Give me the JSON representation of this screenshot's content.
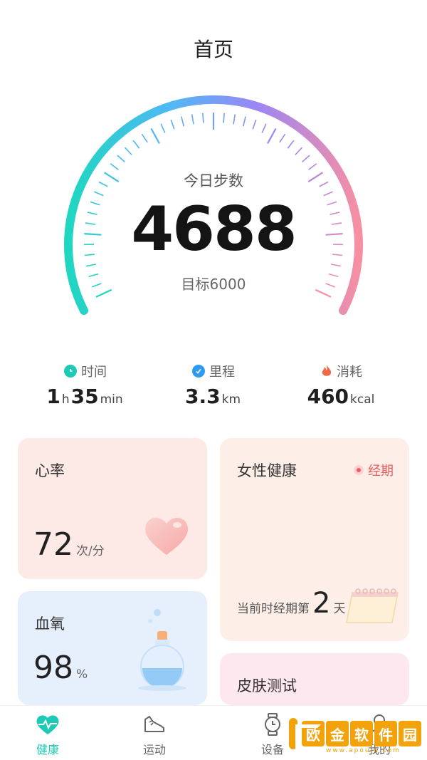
{
  "header": {
    "title": "首页"
  },
  "steps": {
    "label": "今日步数",
    "value": "4688",
    "target_label": "目标6000",
    "progress": 0.78
  },
  "stats": [
    {
      "name": "时间",
      "icon": "clock-icon",
      "color": "#1ec9b5",
      "parts": [
        "1",
        "h",
        "35",
        "min"
      ]
    },
    {
      "name": "里程",
      "icon": "check-icon",
      "color": "#2f9bf0",
      "parts": [
        "3.3",
        "km"
      ]
    },
    {
      "name": "消耗",
      "icon": "flame-icon",
      "color": "#f06a4a",
      "parts": [
        "460",
        "kcal"
      ]
    }
  ],
  "cards": {
    "heart_rate": {
      "title": "心率",
      "value": "72",
      "unit": "次/分"
    },
    "blood_oxygen": {
      "title": "血氧",
      "value": "98",
      "unit": "%"
    },
    "female_health": {
      "title": "女性健康",
      "badge": "经期",
      "prefix": "当前时经期第",
      "day": "2",
      "suffix": "天"
    },
    "skin": {
      "title": "皮肤测试"
    }
  },
  "tabs": [
    {
      "label": "健康",
      "icon": "health-heart-icon",
      "active": true
    },
    {
      "label": "运动",
      "icon": "shoe-icon",
      "active": false
    },
    {
      "label": "设备",
      "icon": "watch-icon",
      "active": false
    },
    {
      "label": "我的",
      "icon": "profile-icon",
      "active": false
    }
  ],
  "watermark": {
    "chars": [
      "欧",
      "金",
      "软",
      "件",
      "园"
    ],
    "sub": "www.apoujn.com"
  },
  "colors": {
    "accent": "#1ec9b5",
    "gauge_start": "#1fd7c0",
    "gauge_mid": "#8a8cf6",
    "gauge_end": "#f48aa6"
  }
}
